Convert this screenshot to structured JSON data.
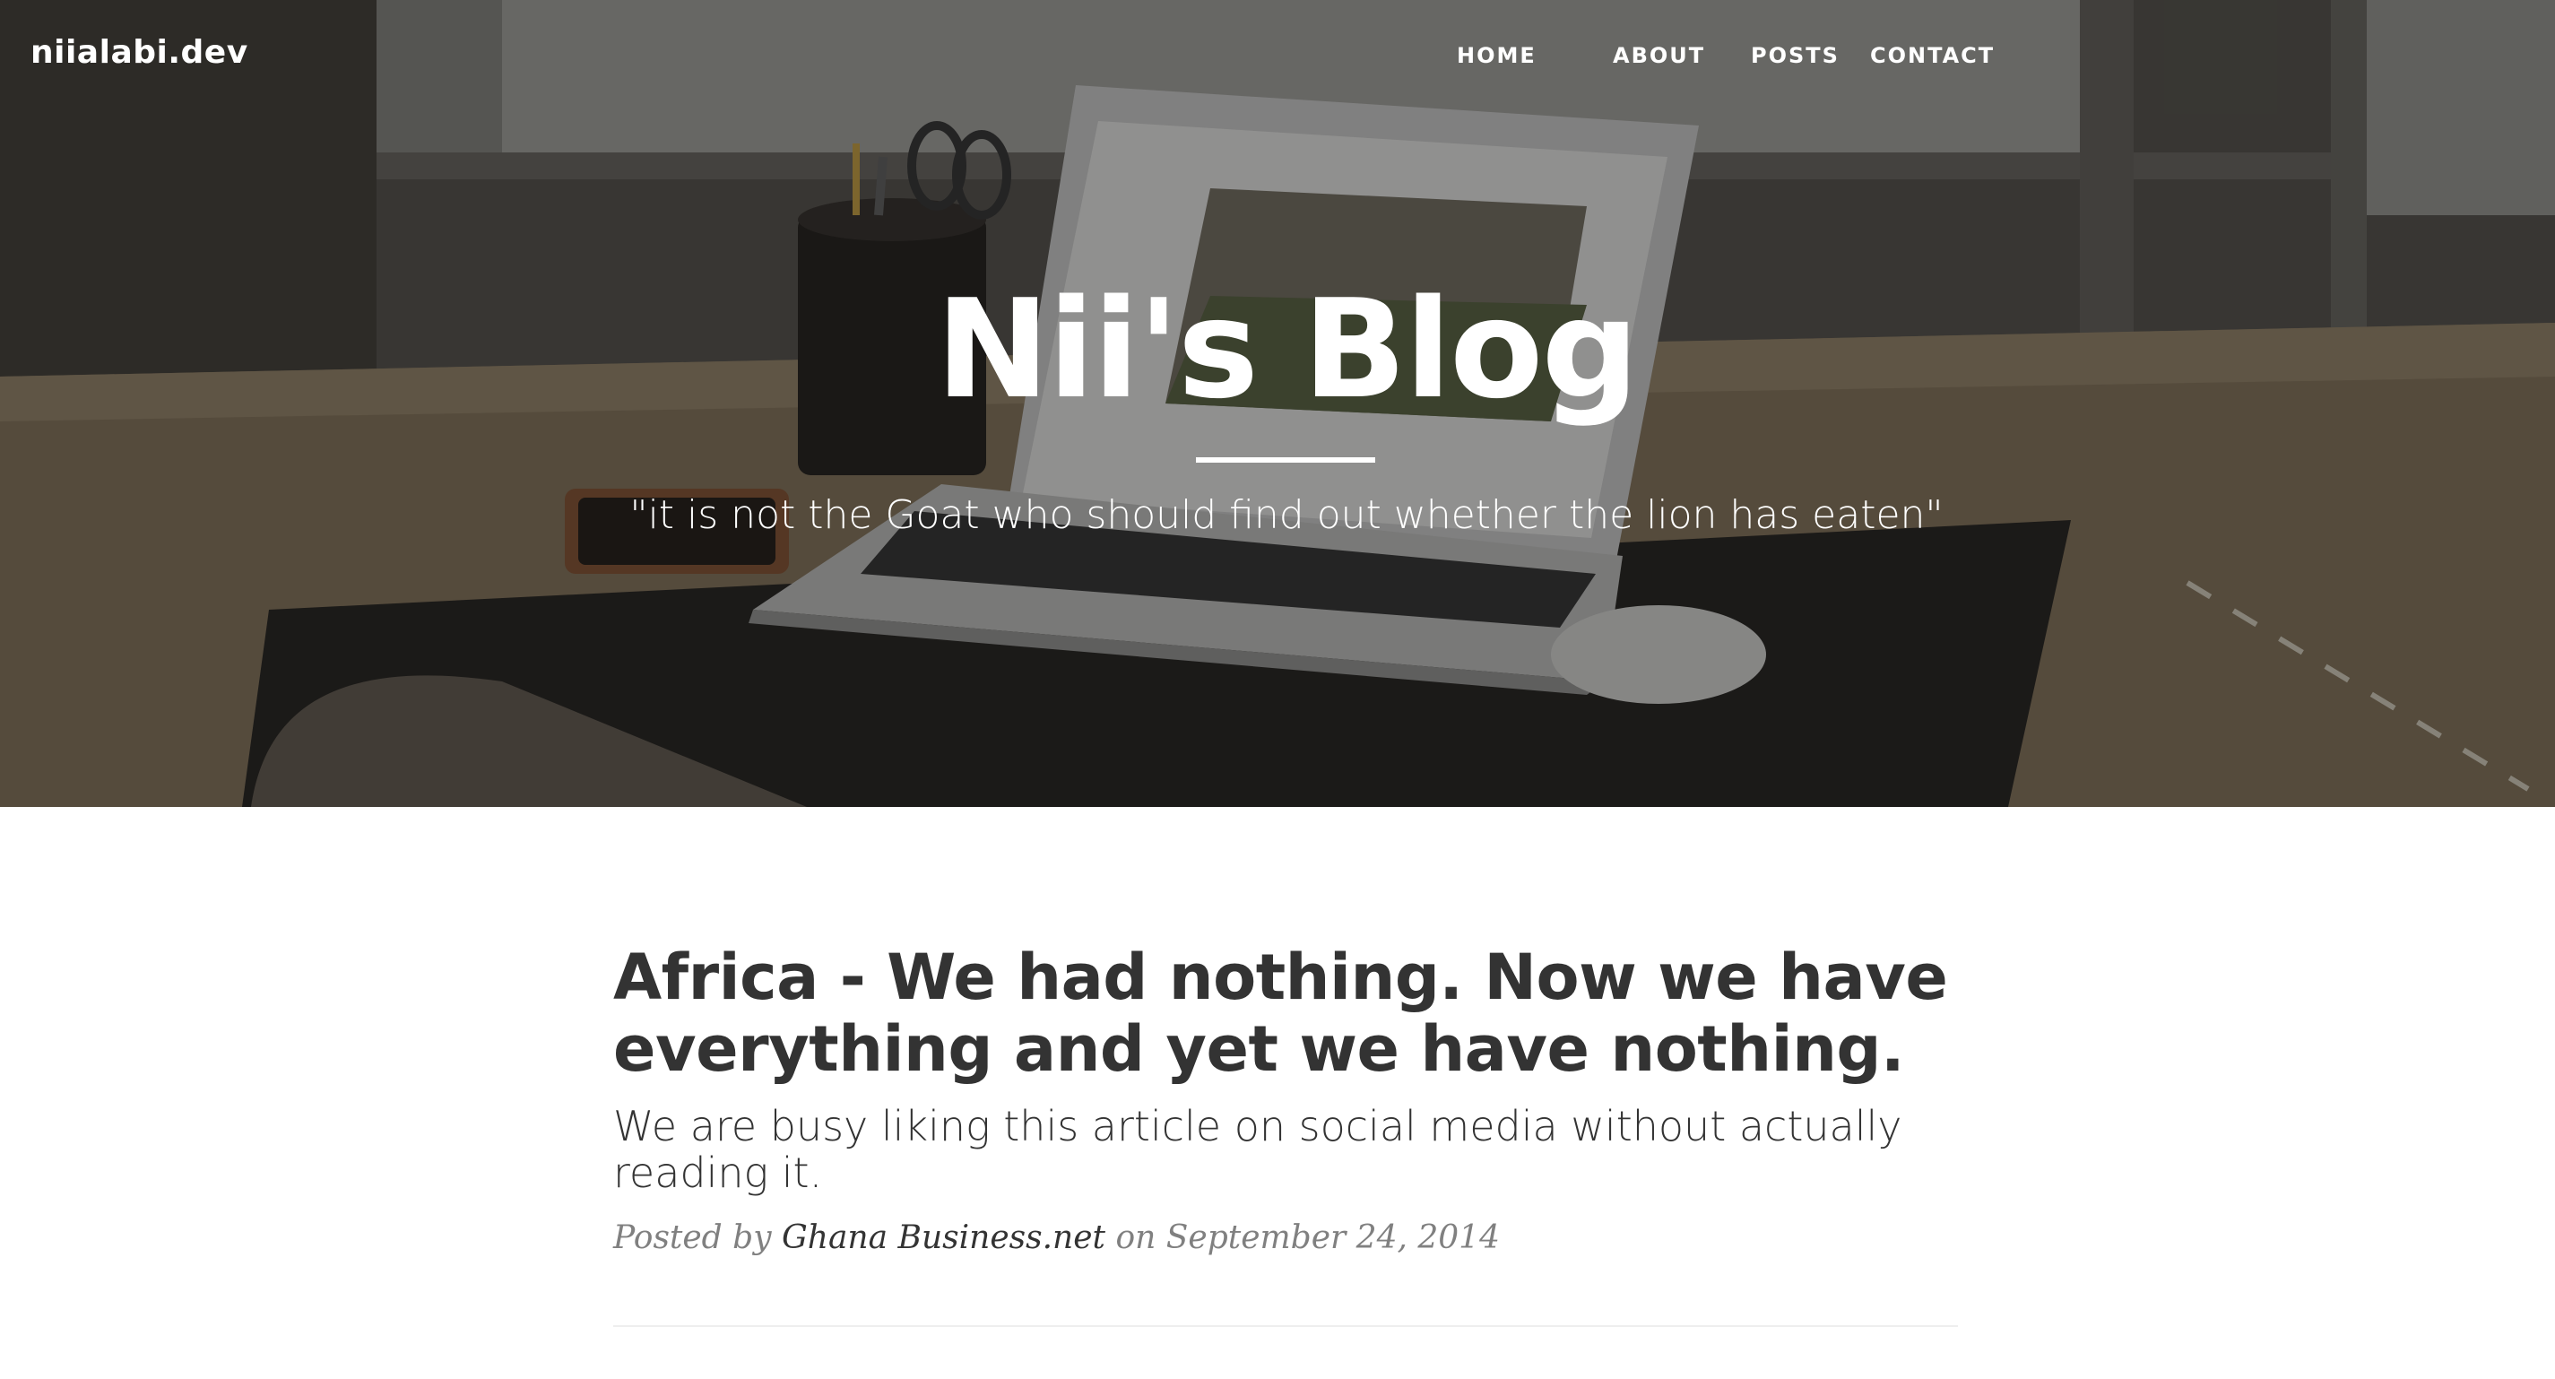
{
  "brand": {
    "label": "niialabi.dev"
  },
  "nav": {
    "items": [
      {
        "label": "HOME"
      },
      {
        "label": "ABOUT"
      },
      {
        "label": "POSTS"
      },
      {
        "label": "CONTACT"
      }
    ]
  },
  "hero": {
    "title": "Nii's Blog",
    "subheading": "\"it is not the Goat who should find out whether the lion has eaten\""
  },
  "posts": [
    {
      "title": "Africa - We had nothing. Now we have everything and yet we have nothing.",
      "subtitle": "We are busy liking this article on social media without actually reading it.",
      "meta_prefix": "Posted by",
      "author": "Ghana Business.net",
      "meta_on": "on",
      "date": "September 24, 2014"
    }
  ],
  "colors": {
    "text_dark": "#333333",
    "text_meta": "#808080",
    "divider": "#eeeeee",
    "hero_text": "#ffffff"
  }
}
